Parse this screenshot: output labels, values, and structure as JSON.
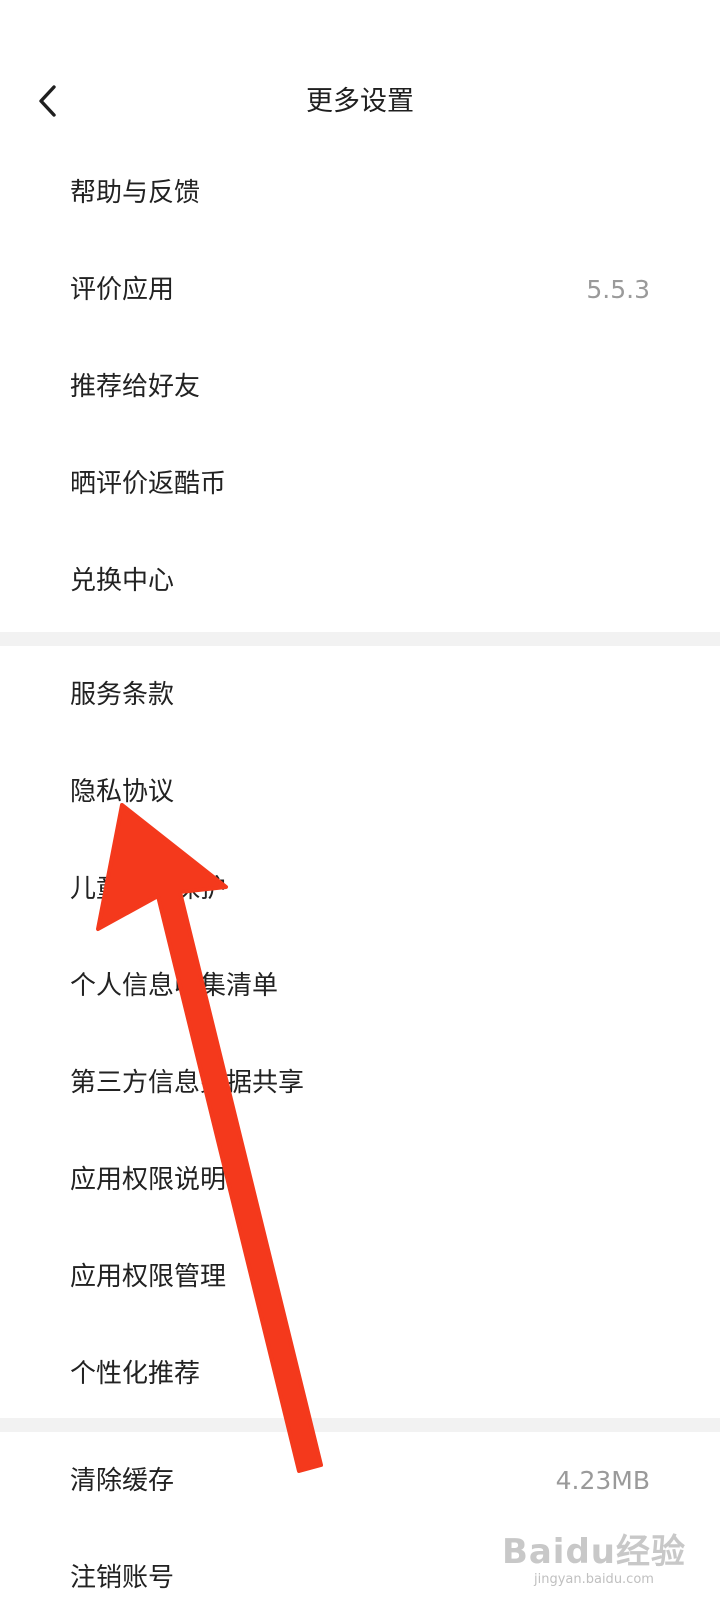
{
  "header": {
    "title": "更多设置"
  },
  "group1": [
    {
      "label": "帮助与反馈",
      "value": ""
    },
    {
      "label": "评价应用",
      "value": "5.5.3"
    },
    {
      "label": "推荐给好友",
      "value": ""
    },
    {
      "label": "晒评价返酷币",
      "value": ""
    },
    {
      "label": "兑换中心",
      "value": ""
    }
  ],
  "group2": [
    {
      "label": "服务条款"
    },
    {
      "label": "隐私协议"
    },
    {
      "label": "儿童隐私保护"
    },
    {
      "label": "个人信息收集清单"
    },
    {
      "label": "第三方信息数据共享"
    },
    {
      "label": "应用权限说明"
    },
    {
      "label": "应用权限管理"
    },
    {
      "label": "个性化推荐"
    }
  ],
  "group3": [
    {
      "label": "清除缓存",
      "value": "4.23MB"
    },
    {
      "label": "注销账号",
      "value": ""
    }
  ],
  "annotation": {
    "arrow_color": "#f4391c"
  },
  "watermark": {
    "logo": "Baidu经验",
    "url": "jingyan.baidu.com"
  }
}
